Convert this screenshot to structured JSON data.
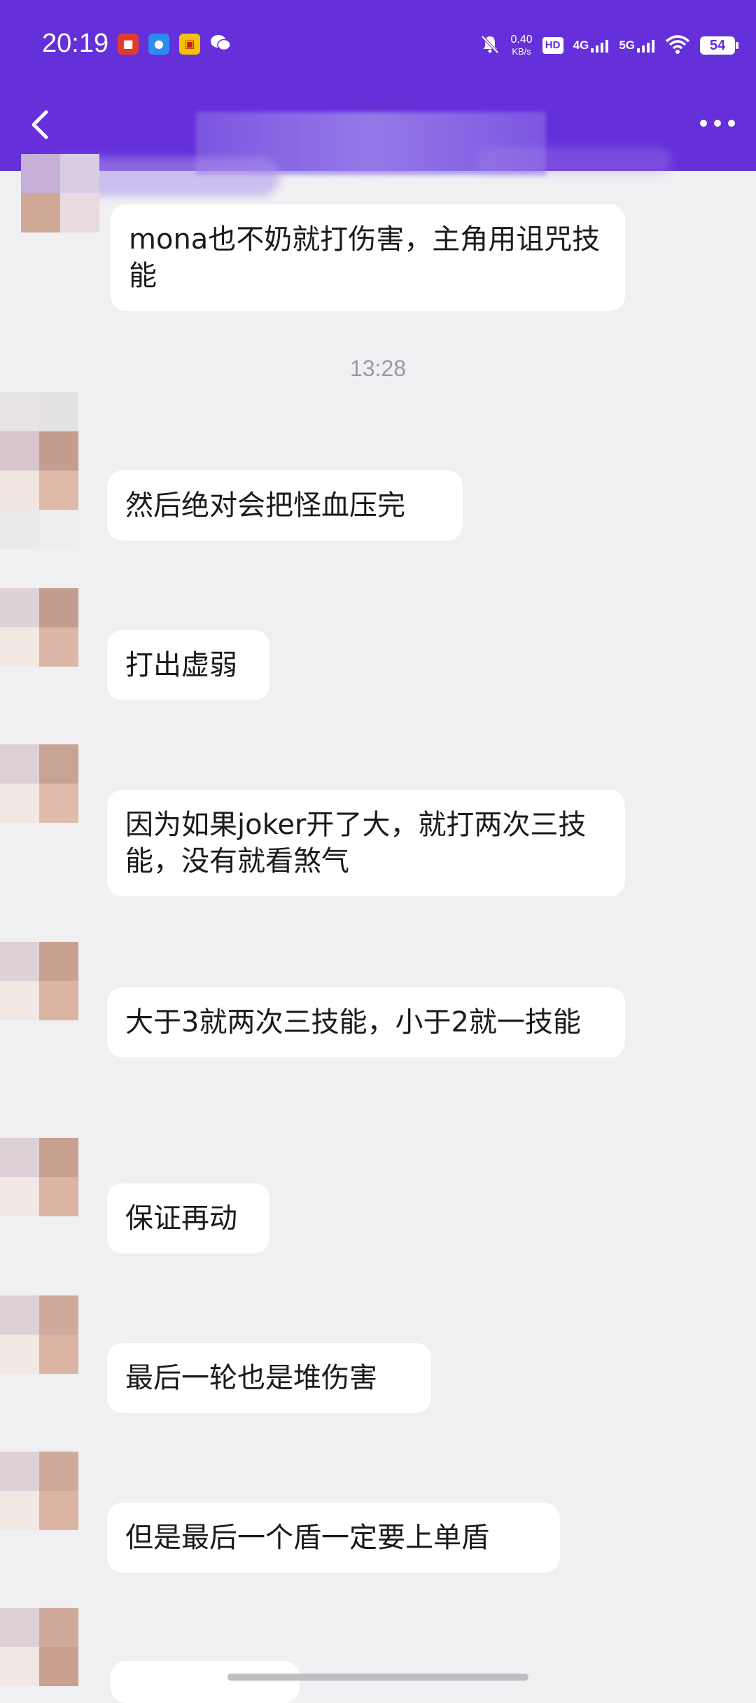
{
  "status_bar": {
    "time": "20:19",
    "net_speed_value": "0.40",
    "net_speed_unit": "KB/s",
    "hd_label": "HD",
    "net1_label": "4G",
    "net2_label": "5G",
    "battery": "54"
  },
  "header": {
    "back_icon": "chevron-left-icon",
    "more_icon": "more-dots-icon"
  },
  "chat": {
    "timestamp": "13:28",
    "messages": [
      {
        "text": "mona也不奶就打伤害，主角用诅咒技能"
      },
      {
        "text": "然后绝对会把怪血压完"
      },
      {
        "text": "打出虚弱"
      },
      {
        "text": "因为如果joker开了大，就打两次三技能，没有就看煞气"
      },
      {
        "text": "大于3就两次三技能，小于2就一技能"
      },
      {
        "text": "保证再动"
      },
      {
        "text": "最后一轮也是堆伤害"
      },
      {
        "text": "但是最后一个盾一定要上单盾"
      }
    ]
  },
  "colors": {
    "header_bg": "#6530d9",
    "chat_bg": "#f0f0f2",
    "bubble_bg": "#ffffff",
    "text": "#1a1a1a",
    "timestamp": "#999aa0"
  }
}
